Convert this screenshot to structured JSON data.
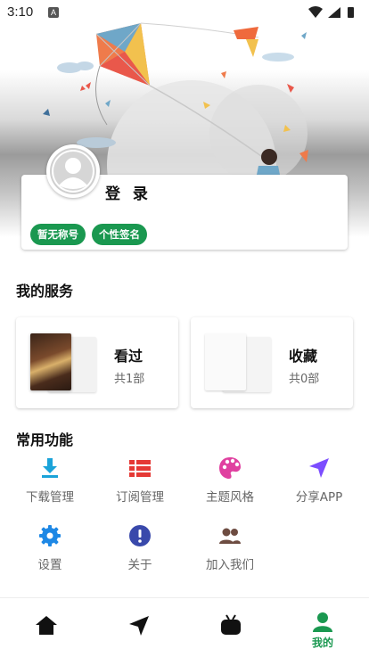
{
  "status_bar": {
    "time": "3:10",
    "notification_icon": "A"
  },
  "profile": {
    "login_label": "登 录",
    "chips": [
      "暂无称号",
      "个性签名"
    ]
  },
  "services": {
    "title": "我的服务",
    "cards": [
      {
        "label": "看过",
        "count": "共1部"
      },
      {
        "label": "收藏",
        "count": "共0部"
      }
    ]
  },
  "functions": {
    "title": "常用功能",
    "items": [
      {
        "label": "下载管理",
        "icon": "download-icon",
        "color": "#1aa3d9"
      },
      {
        "label": "订阅管理",
        "icon": "list-icon",
        "color": "#e53935"
      },
      {
        "label": "主题风格",
        "icon": "palette-icon",
        "color": "#e040a0"
      },
      {
        "label": "分享APP",
        "icon": "send-icon",
        "color": "#7c4dff"
      },
      {
        "label": "设置",
        "icon": "gear-icon",
        "color": "#1e88e5"
      },
      {
        "label": "关于",
        "icon": "info-icon",
        "color": "#3949ab"
      },
      {
        "label": "加入我们",
        "icon": "group-icon",
        "color": "#6d4c41"
      }
    ]
  },
  "bottom_nav": {
    "items": [
      {
        "name": "home",
        "icon": "home-icon"
      },
      {
        "name": "discover",
        "icon": "send-icon"
      },
      {
        "name": "tv",
        "icon": "tv-icon"
      },
      {
        "name": "mine",
        "icon": "person-icon",
        "label": "我的",
        "active": true
      }
    ],
    "active_color": "#1a9850"
  }
}
